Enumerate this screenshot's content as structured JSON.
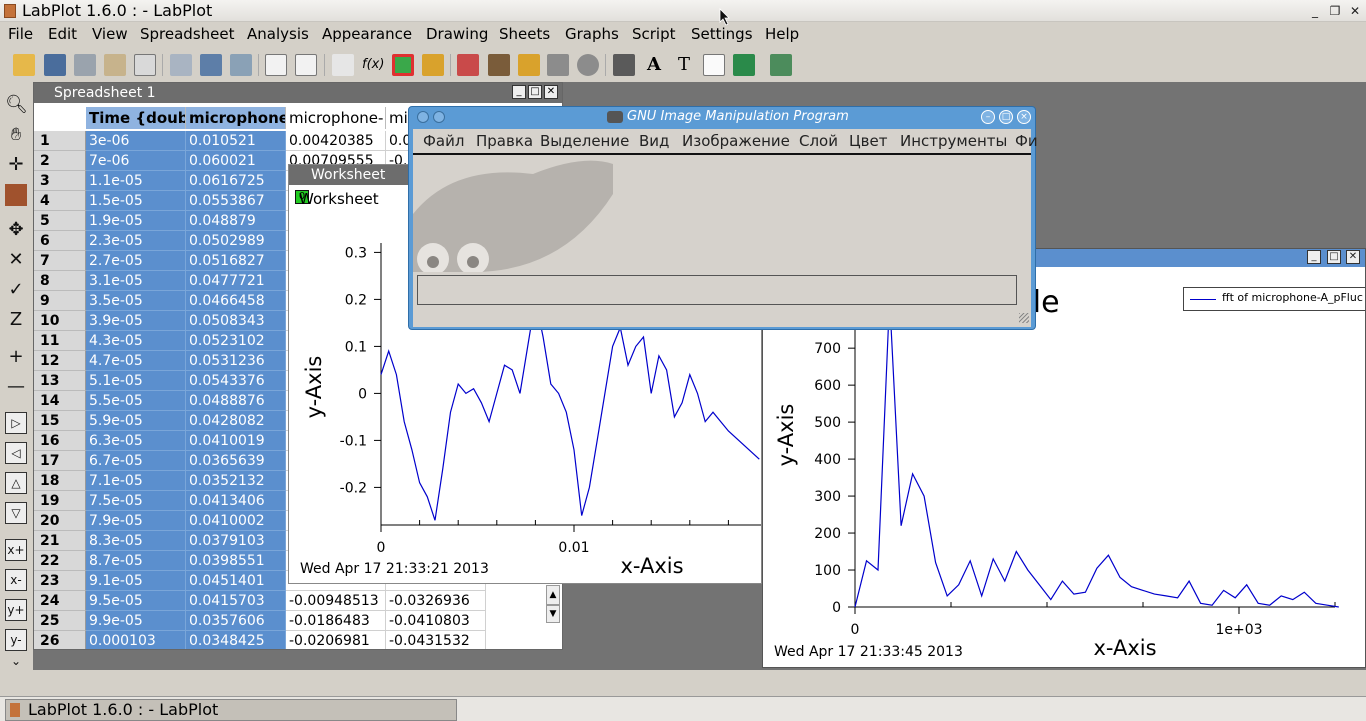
{
  "app_title": "LabPlot 1.6.0 :  - LabPlot",
  "menu": [
    {
      "label": "File",
      "x": 8
    },
    {
      "label": "Edit",
      "x": 48
    },
    {
      "label": "View",
      "x": 92
    },
    {
      "label": "Spreadsheet",
      "x": 140
    },
    {
      "label": "Analysis",
      "x": 247
    },
    {
      "label": "Appearance",
      "x": 322
    },
    {
      "label": "Drawing",
      "x": 426
    },
    {
      "label": "Sheets",
      "x": 499
    },
    {
      "label": "Graphs",
      "x": 565
    },
    {
      "label": "Script",
      "x": 632
    },
    {
      "label": "Settings",
      "x": 691
    },
    {
      "label": "Help",
      "x": 765
    }
  ],
  "spreadsheet": {
    "title": "Spreadsheet 1",
    "headers": [
      "Time {doub",
      "microphone",
      "microphone-",
      "mi"
    ],
    "rows": [
      [
        "1",
        "3e-06",
        "0.010521",
        "0.00420385",
        "0.0"
      ],
      [
        "2",
        "7e-06",
        "0.060021",
        "0.00709555",
        "-0."
      ],
      [
        "3",
        "1.1e-05",
        "0.0616725",
        "",
        ""
      ],
      [
        "4",
        "1.5e-05",
        "0.0553867",
        "",
        ""
      ],
      [
        "5",
        "1.9e-05",
        "0.048879",
        "",
        ""
      ],
      [
        "6",
        "2.3e-05",
        "0.0502989",
        "",
        ""
      ],
      [
        "7",
        "2.7e-05",
        "0.0516827",
        "",
        ""
      ],
      [
        "8",
        "3.1e-05",
        "0.0477721",
        "",
        ""
      ],
      [
        "9",
        "3.5e-05",
        "0.0466458",
        "",
        ""
      ],
      [
        "10",
        "3.9e-05",
        "0.0508343",
        "",
        ""
      ],
      [
        "11",
        "4.3e-05",
        "0.0523102",
        "",
        ""
      ],
      [
        "12",
        "4.7e-05",
        "0.0531236",
        "",
        ""
      ],
      [
        "13",
        "5.1e-05",
        "0.0543376",
        "",
        ""
      ],
      [
        "14",
        "5.5e-05",
        "0.0488876",
        "",
        ""
      ],
      [
        "15",
        "5.9e-05",
        "0.0428082",
        "",
        ""
      ],
      [
        "16",
        "6.3e-05",
        "0.0410019",
        "",
        ""
      ],
      [
        "17",
        "6.7e-05",
        "0.0365639",
        "",
        ""
      ],
      [
        "18",
        "7.1e-05",
        "0.0352132",
        "",
        ""
      ],
      [
        "19",
        "7.5e-05",
        "0.0413406",
        "",
        ""
      ],
      [
        "20",
        "7.9e-05",
        "0.0410002",
        "",
        ""
      ],
      [
        "21",
        "8.3e-05",
        "0.0379103",
        "",
        ""
      ],
      [
        "22",
        "8.7e-05",
        "0.0398551",
        "",
        ""
      ],
      [
        "23",
        "9.1e-05",
        "0.0451401",
        "",
        ""
      ],
      [
        "24",
        "9.5e-05",
        "0.0415703",
        "-0.00948513",
        "-0.0326936"
      ],
      [
        "25",
        "9.9e-05",
        "0.0357606",
        "-0.0186483",
        "-0.0410803"
      ],
      [
        "26",
        "0.000103",
        "0.0348425",
        "-0.0206981",
        "-0.0431532"
      ]
    ]
  },
  "worksheet1": {
    "title": "Worksheet",
    "tab_label": "Worksheet",
    "tab_badge": "0",
    "timestamp": "Wed Apr 17 21:33:21 2013"
  },
  "worksheet2": {
    "title_fragment": "tle",
    "legend": "fft of microphone-A_pFluc",
    "timestamp": "Wed Apr 17 21:33:45 2013"
  },
  "gimp": {
    "title": "GNU Image Manipulation Program",
    "menu": [
      {
        "label": "Файл",
        "x": 10
      },
      {
        "label": "Правка",
        "x": 63
      },
      {
        "label": "Выделение",
        "x": 127
      },
      {
        "label": "Вид",
        "x": 226
      },
      {
        "label": "Изображение",
        "x": 269
      },
      {
        "label": "Слой",
        "x": 386
      },
      {
        "label": "Цвет",
        "x": 436
      },
      {
        "label": "Инструменты",
        "x": 487
      },
      {
        "label": "Фи",
        "x": 602
      }
    ]
  },
  "taskbar_item": "LabPlot 1.6.0 :  - LabPlot",
  "chart_data": [
    {
      "type": "line",
      "title": "",
      "xlabel": "x-Axis",
      "ylabel": "y-Axis",
      "xlim": [
        0,
        0.02
      ],
      "ylim": [
        -0.28,
        0.32
      ],
      "xticks": [
        "0",
        "0.01",
        "0"
      ],
      "yticks": [
        "0.3",
        "0.2",
        "0.1",
        "0",
        "-0.1",
        "-0.2"
      ],
      "series": [
        {
          "color": "#0000cc",
          "x": [
            0,
            0.0004,
            0.0008,
            0.0012,
            0.0016,
            0.002,
            0.0024,
            0.0028,
            0.0032,
            0.0036,
            0.004,
            0.0044,
            0.0048,
            0.0052,
            0.0056,
            0.006,
            0.0064,
            0.0068,
            0.0072,
            0.0076,
            0.008,
            0.0084,
            0.0088,
            0.0092,
            0.0096,
            0.01,
            0.0104,
            0.0108,
            0.0112,
            0.0116,
            0.012,
            0.0124,
            0.0128,
            0.0132,
            0.0136,
            0.014,
            0.0144,
            0.0148,
            0.0152,
            0.0156,
            0.016,
            0.0164,
            0.0168,
            0.0172,
            0.0176,
            0.018,
            0.0196
          ],
          "y": [
            0.04,
            0.09,
            0.04,
            -0.06,
            -0.12,
            -0.19,
            -0.22,
            -0.27,
            -0.16,
            -0.04,
            0.02,
            0.0,
            0.01,
            -0.02,
            -0.06,
            0.0,
            0.06,
            0.05,
            0.0,
            0.1,
            0.2,
            0.12,
            0.02,
            0.0,
            -0.04,
            -0.12,
            -0.26,
            -0.2,
            -0.1,
            0.0,
            0.1,
            0.14,
            0.06,
            0.1,
            0.12,
            0.0,
            0.08,
            0.05,
            -0.05,
            -0.02,
            0.04,
            0.0,
            -0.06,
            -0.04,
            -0.06,
            -0.08,
            -0.14
          ]
        }
      ]
    },
    {
      "type": "line",
      "title": "",
      "xlabel": "x-Axis",
      "ylabel": "y-Axis",
      "xlim": [
        0,
        1250
      ],
      "ylim": [
        0,
        860
      ],
      "xticks": [
        "0",
        "1e+03"
      ],
      "yticks": [
        "0",
        "100",
        "200",
        "300",
        "400",
        "500",
        "600",
        "700",
        "800"
      ],
      "series": [
        {
          "name": "fft of microphone-A_pFluc",
          "color": "#0000cc",
          "x": [
            0,
            30,
            60,
            90,
            120,
            150,
            180,
            210,
            240,
            270,
            300,
            330,
            360,
            390,
            420,
            450,
            480,
            510,
            540,
            570,
            600,
            630,
            660,
            690,
            720,
            750,
            780,
            810,
            840,
            870,
            900,
            930,
            960,
            990,
            1020,
            1050,
            1080,
            1110,
            1140,
            1170,
            1200,
            1230,
            1260
          ],
          "y": [
            0,
            125,
            100,
            835,
            220,
            360,
            300,
            120,
            30,
            60,
            125,
            30,
            130,
            70,
            150,
            100,
            60,
            20,
            70,
            35,
            40,
            105,
            140,
            80,
            55,
            45,
            35,
            30,
            25,
            70,
            10,
            5,
            45,
            25,
            60,
            10,
            5,
            30,
            20,
            40,
            10,
            5,
            0
          ]
        }
      ]
    }
  ]
}
